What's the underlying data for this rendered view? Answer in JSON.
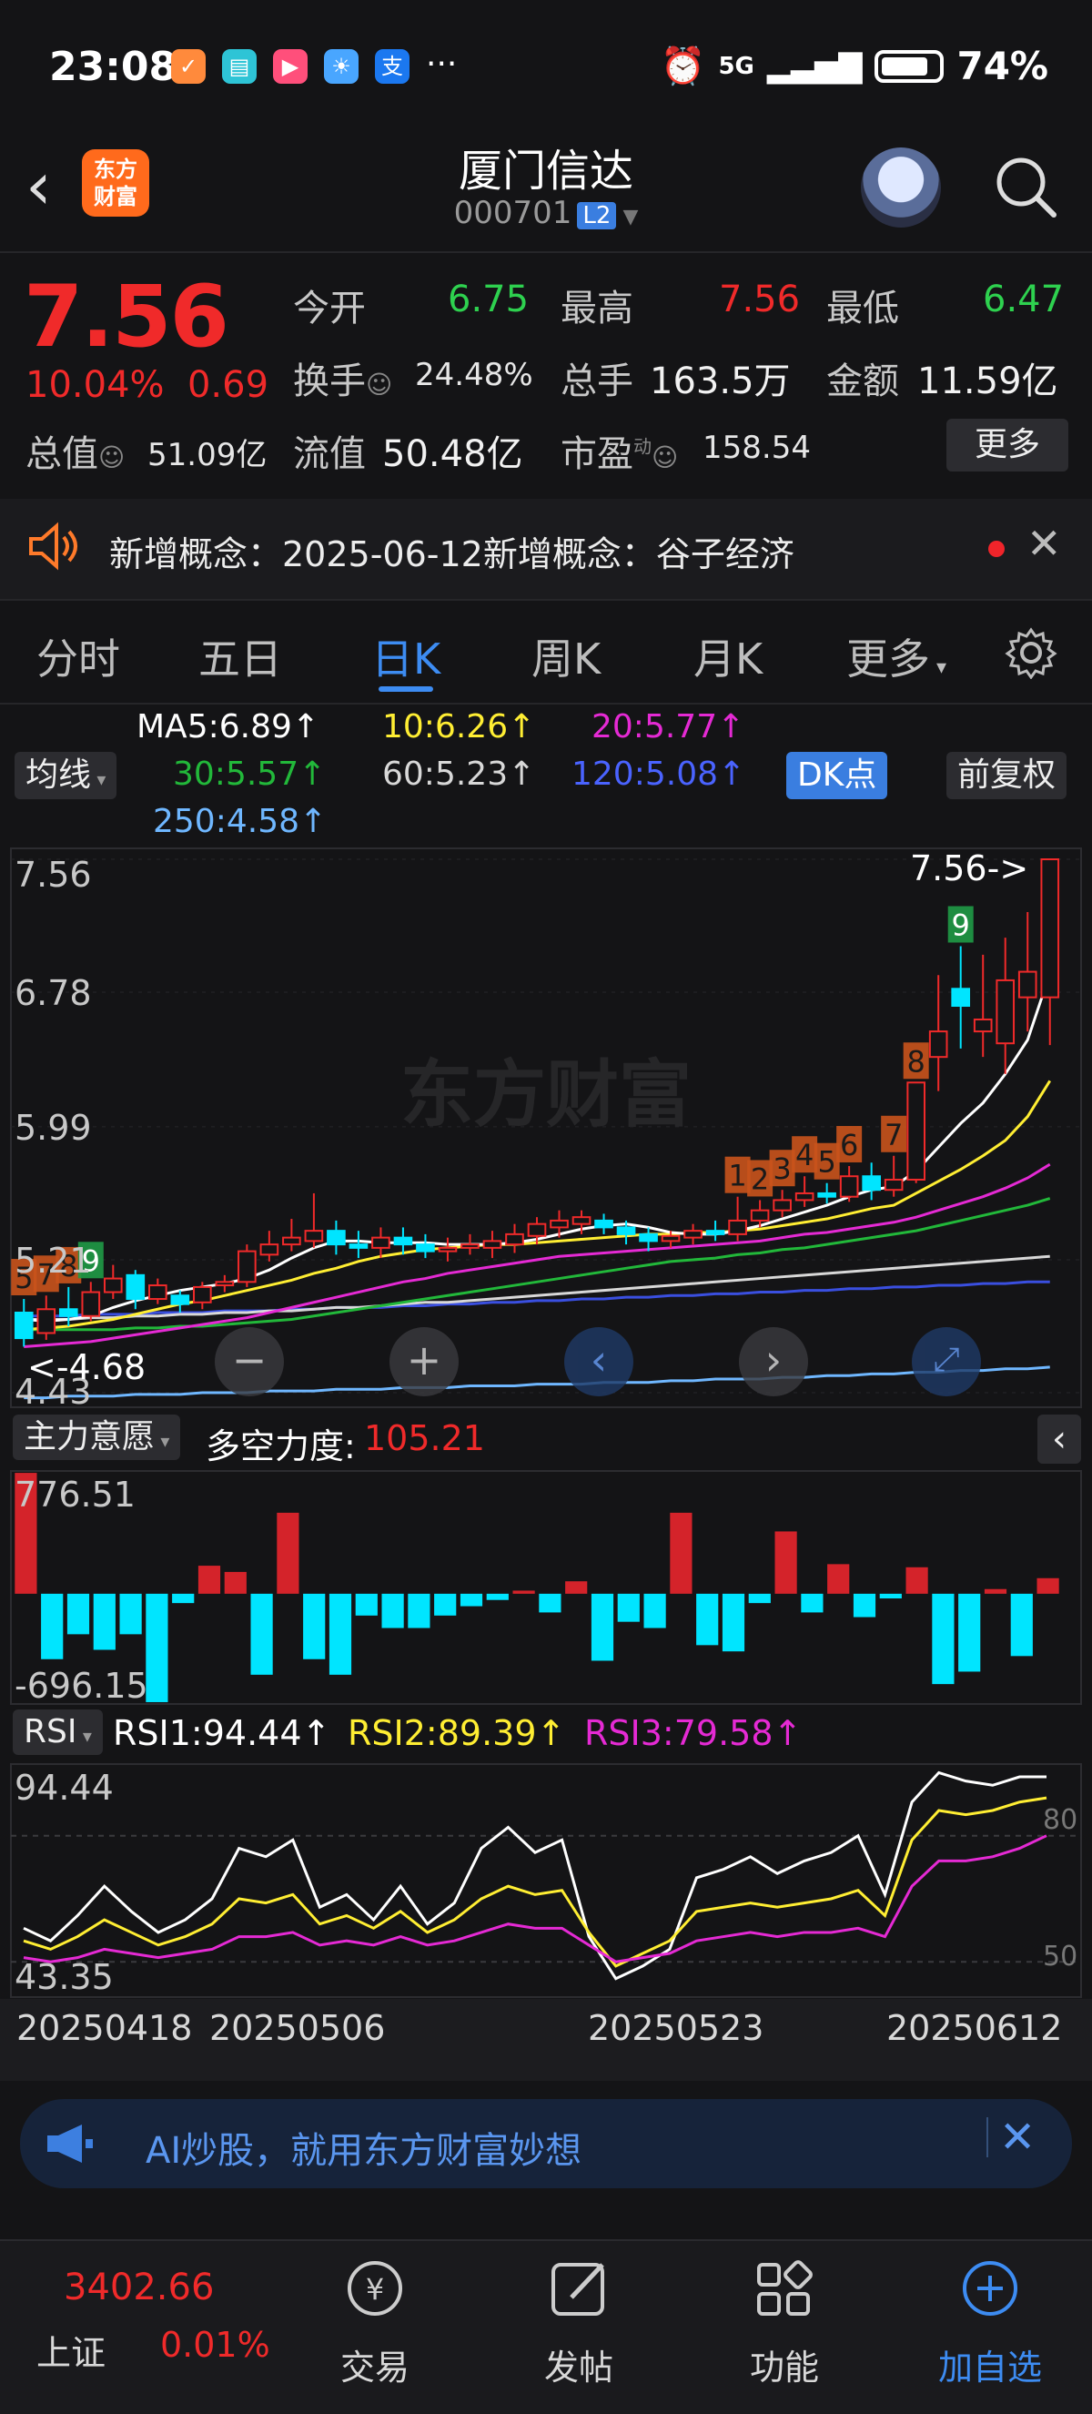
{
  "status": {
    "time": "23:08",
    "network": "5G",
    "battery": "74%",
    "more": "···",
    "app_icons": [
      "coupon-app-icon",
      "book-app-icon",
      "video-app-icon",
      "weather-app-icon",
      "alipay-icon"
    ]
  },
  "header": {
    "back_icon": "chevron-left-icon",
    "logo_line1": "东方",
    "logo_line2": "财富",
    "stock_name": "厦门信达",
    "stock_code": "000701",
    "level_badge": "L2"
  },
  "quote": {
    "price": "7.56",
    "change_pct": "10.04%",
    "change_amt": "0.69",
    "open_label": "今开",
    "open": "6.75",
    "high_label": "最高",
    "high": "7.56",
    "low_label": "最低",
    "low": "6.47",
    "turnover_label": "换手",
    "turnover": "24.48%",
    "volume_label": "总手",
    "volume": "163.5万",
    "amount_label": "金额",
    "amount": "11.59亿",
    "mcap_label": "总值",
    "mcap": "51.09亿",
    "float_label": "流值",
    "float": "50.48亿",
    "pe_label": "市盈",
    "pe_sup": "动",
    "pe": "158.54",
    "more_button": "更多"
  },
  "notice": {
    "text": "新增概念：2025-06-12新增概念：谷子经济"
  },
  "tabs": [
    "分时",
    "五日",
    "日K",
    "周K",
    "月K",
    "更多"
  ],
  "active_tab": "日K",
  "ma_legend": {
    "ma5": "MA5:6.89↑",
    "ma10": "10:6.26↑",
    "ma20": "20:5.77↑",
    "ma30": "30:5.57↑",
    "ma60": "60:5.23↑",
    "ma120": "120:5.08↑",
    "ma250": "250:4.58↑",
    "selector": "均线",
    "dk_button": "DK点",
    "adjust_button": "前复权"
  },
  "colors": {
    "up": "#f02a2a",
    "down": "#00e5ff",
    "ma5": "#ffffff",
    "ma10": "#ffee33",
    "ma20": "#e52ad4",
    "ma30": "#22b83a",
    "ma60": "#d8d8d8",
    "ma120": "#3a4fe0",
    "ma250": "#6fb7ff",
    "accent": "#3d8cf2"
  },
  "chart_data": [
    {
      "type": "candlestick",
      "title": "",
      "ylim": [
        4.43,
        7.56
      ],
      "y_ticks": [
        "7.56",
        "6.78",
        "5.99",
        "5.21",
        "4.43"
      ],
      "high_marker": "7.56->",
      "low_marker": "<-4.68",
      "dates": [
        "20250418",
        "20250506",
        "20250523",
        "20250612"
      ],
      "candles": [
        {
          "o": 4.9,
          "c": 4.75,
          "h": 4.98,
          "l": 4.7
        },
        {
          "o": 4.78,
          "c": 4.92,
          "h": 5.0,
          "l": 4.74
        },
        {
          "o": 4.92,
          "c": 4.88,
          "h": 5.05,
          "l": 4.82
        },
        {
          "o": 4.88,
          "c": 5.02,
          "h": 5.08,
          "l": 4.85
        },
        {
          "o": 5.02,
          "c": 5.1,
          "h": 5.18,
          "l": 4.98
        },
        {
          "o": 5.12,
          "c": 4.98,
          "h": 5.15,
          "l": 4.92
        },
        {
          "o": 4.98,
          "c": 5.06,
          "h": 5.1,
          "l": 4.95
        },
        {
          "o": 5.0,
          "c": 4.95,
          "h": 5.03,
          "l": 4.9
        },
        {
          "o": 4.96,
          "c": 5.05,
          "h": 5.08,
          "l": 4.92
        },
        {
          "o": 5.06,
          "c": 5.08,
          "h": 5.12,
          "l": 5.02
        },
        {
          "o": 5.08,
          "c": 5.26,
          "h": 5.3,
          "l": 5.05
        },
        {
          "o": 5.24,
          "c": 5.3,
          "h": 5.38,
          "l": 5.2
        },
        {
          "o": 5.3,
          "c": 5.34,
          "h": 5.45,
          "l": 5.26
        },
        {
          "o": 5.32,
          "c": 5.38,
          "h": 5.6,
          "l": 5.28
        },
        {
          "o": 5.38,
          "c": 5.3,
          "h": 5.44,
          "l": 5.24
        },
        {
          "o": 5.3,
          "c": 5.28,
          "h": 5.38,
          "l": 5.22
        },
        {
          "o": 5.28,
          "c": 5.34,
          "h": 5.4,
          "l": 5.22
        },
        {
          "o": 5.34,
          "c": 5.3,
          "h": 5.4,
          "l": 5.24
        },
        {
          "o": 5.3,
          "c": 5.26,
          "h": 5.36,
          "l": 5.22
        },
        {
          "o": 5.26,
          "c": 5.28,
          "h": 5.34,
          "l": 5.2
        },
        {
          "o": 5.28,
          "c": 5.3,
          "h": 5.36,
          "l": 5.24
        },
        {
          "o": 5.28,
          "c": 5.32,
          "h": 5.38,
          "l": 5.22
        },
        {
          "o": 5.3,
          "c": 5.36,
          "h": 5.42,
          "l": 5.25
        },
        {
          "o": 5.35,
          "c": 5.42,
          "h": 5.46,
          "l": 5.3
        },
        {
          "o": 5.4,
          "c": 5.44,
          "h": 5.5,
          "l": 5.34
        },
        {
          "o": 5.42,
          "c": 5.46,
          "h": 5.5,
          "l": 5.36
        },
        {
          "o": 5.44,
          "c": 5.4,
          "h": 5.48,
          "l": 5.36
        },
        {
          "o": 5.4,
          "c": 5.36,
          "h": 5.44,
          "l": 5.3
        },
        {
          "o": 5.36,
          "c": 5.32,
          "h": 5.4,
          "l": 5.26
        },
        {
          "o": 5.32,
          "c": 5.35,
          "h": 5.38,
          "l": 5.28
        },
        {
          "o": 5.34,
          "c": 5.38,
          "h": 5.42,
          "l": 5.3
        },
        {
          "o": 5.38,
          "c": 5.36,
          "h": 5.44,
          "l": 5.32
        },
        {
          "o": 5.36,
          "c": 5.44,
          "h": 5.58,
          "l": 5.32
        },
        {
          "o": 5.44,
          "c": 5.5,
          "h": 5.56,
          "l": 5.4
        },
        {
          "o": 5.5,
          "c": 5.56,
          "h": 5.62,
          "l": 5.46
        },
        {
          "o": 5.56,
          "c": 5.6,
          "h": 5.7,
          "l": 5.52
        },
        {
          "o": 5.6,
          "c": 5.58,
          "h": 5.66,
          "l": 5.54
        },
        {
          "o": 5.58,
          "c": 5.7,
          "h": 5.76,
          "l": 5.55
        },
        {
          "o": 5.7,
          "c": 5.62,
          "h": 5.78,
          "l": 5.56
        },
        {
          "o": 5.62,
          "c": 5.68,
          "h": 5.82,
          "l": 5.58
        },
        {
          "o": 5.68,
          "c": 6.25,
          "h": 6.25,
          "l": 5.66
        },
        {
          "o": 6.4,
          "c": 6.55,
          "h": 6.88,
          "l": 6.2
        },
        {
          "o": 6.8,
          "c": 6.7,
          "h": 7.05,
          "l": 6.45
        },
        {
          "o": 6.55,
          "c": 6.62,
          "h": 7.0,
          "l": 6.4
        },
        {
          "o": 6.48,
          "c": 6.85,
          "h": 7.1,
          "l": 6.3
        },
        {
          "o": 6.75,
          "c": 6.9,
          "h": 7.25,
          "l": 6.55
        },
        {
          "o": 6.75,
          "c": 7.56,
          "h": 7.56,
          "l": 6.47
        }
      ],
      "ma5": [
        4.86,
        4.85,
        4.86,
        4.88,
        4.93,
        4.97,
        5.0,
        5.03,
        5.05,
        5.07,
        5.1,
        5.15,
        5.22,
        5.28,
        5.32,
        5.32,
        5.31,
        5.31,
        5.31,
        5.3,
        5.3,
        5.3,
        5.31,
        5.33,
        5.36,
        5.39,
        5.41,
        5.42,
        5.4,
        5.37,
        5.36,
        5.36,
        5.38,
        5.41,
        5.45,
        5.49,
        5.53,
        5.58,
        5.62,
        5.64,
        5.73,
        5.87,
        6.01,
        6.13,
        6.3,
        6.5,
        6.89
      ],
      "ma10": [
        4.8,
        4.81,
        4.82,
        4.84,
        4.86,
        4.89,
        4.92,
        4.95,
        4.97,
        5.0,
        5.03,
        5.06,
        5.09,
        5.13,
        5.16,
        5.2,
        5.23,
        5.25,
        5.27,
        5.28,
        5.29,
        5.3,
        5.3,
        5.31,
        5.32,
        5.33,
        5.34,
        5.35,
        5.36,
        5.36,
        5.37,
        5.37,
        5.38,
        5.39,
        5.41,
        5.43,
        5.45,
        5.48,
        5.51,
        5.53,
        5.6,
        5.67,
        5.74,
        5.82,
        5.91,
        6.05,
        6.26
      ],
      "ma20": [
        4.7,
        4.71,
        4.72,
        4.73,
        4.75,
        4.77,
        4.79,
        4.81,
        4.83,
        4.85,
        4.87,
        4.9,
        4.93,
        4.96,
        4.99,
        5.02,
        5.05,
        5.08,
        5.1,
        5.13,
        5.15,
        5.17,
        5.19,
        5.21,
        5.23,
        5.24,
        5.25,
        5.26,
        5.27,
        5.28,
        5.29,
        5.3,
        5.31,
        5.32,
        5.34,
        5.36,
        5.37,
        5.39,
        5.41,
        5.43,
        5.46,
        5.5,
        5.54,
        5.58,
        5.63,
        5.69,
        5.77
      ],
      "ma30": [
        4.8,
        4.8,
        4.8,
        4.8,
        4.8,
        4.81,
        4.81,
        4.82,
        4.82,
        4.83,
        4.84,
        4.85,
        4.86,
        4.88,
        4.9,
        4.92,
        4.94,
        4.96,
        4.98,
        5.0,
        5.02,
        5.04,
        5.06,
        5.08,
        5.1,
        5.12,
        5.14,
        5.16,
        5.18,
        5.2,
        5.21,
        5.22,
        5.24,
        5.25,
        5.27,
        5.28,
        5.3,
        5.32,
        5.34,
        5.36,
        5.38,
        5.41,
        5.44,
        5.47,
        5.5,
        5.53,
        5.57
      ],
      "ma60": [
        4.86,
        4.86,
        4.86,
        4.87,
        4.87,
        4.88,
        4.88,
        4.89,
        4.89,
        4.9,
        4.9,
        4.91,
        4.91,
        4.92,
        4.93,
        4.93,
        4.94,
        4.95,
        4.96,
        4.96,
        4.97,
        4.98,
        4.99,
        5.0,
        5.01,
        5.02,
        5.03,
        5.04,
        5.05,
        5.06,
        5.07,
        5.08,
        5.09,
        5.1,
        5.11,
        5.12,
        5.13,
        5.14,
        5.15,
        5.16,
        5.17,
        5.18,
        5.19,
        5.2,
        5.21,
        5.22,
        5.23
      ],
      "ma120": [
        4.88,
        4.88,
        4.88,
        4.89,
        4.89,
        4.89,
        4.9,
        4.9,
        4.9,
        4.91,
        4.91,
        4.91,
        4.92,
        4.92,
        4.93,
        4.93,
        4.93,
        4.94,
        4.94,
        4.95,
        4.95,
        4.96,
        4.96,
        4.97,
        4.97,
        4.98,
        4.98,
        4.99,
        4.99,
        5.0,
        5.0,
        5.01,
        5.01,
        5.02,
        5.02,
        5.03,
        5.03,
        5.04,
        5.04,
        5.05,
        5.05,
        5.06,
        5.06,
        5.07,
        5.07,
        5.08,
        5.08
      ],
      "ma250": [
        4.4,
        4.4,
        4.41,
        4.41,
        4.41,
        4.42,
        4.42,
        4.42,
        4.43,
        4.43,
        4.43,
        4.44,
        4.44,
        4.44,
        4.45,
        4.45,
        4.45,
        4.46,
        4.46,
        4.46,
        4.47,
        4.47,
        4.47,
        4.48,
        4.48,
        4.48,
        4.49,
        4.49,
        4.49,
        4.5,
        4.5,
        4.51,
        4.51,
        4.51,
        4.52,
        4.52,
        4.53,
        4.53,
        4.54,
        4.54,
        4.55,
        4.55,
        4.56,
        4.56,
        4.57,
        4.57,
        4.58
      ],
      "signals": [
        {
          "i": 0,
          "label": "5"
        },
        {
          "i": 1,
          "label": "7"
        },
        {
          "i": 2,
          "label": "8"
        },
        {
          "i": 3,
          "label": "9"
        },
        {
          "i": 32,
          "label": "1"
        },
        {
          "i": 33,
          "label": "2"
        },
        {
          "i": 34,
          "label": "3"
        },
        {
          "i": 35,
          "label": "4"
        },
        {
          "i": 36,
          "label": "5"
        },
        {
          "i": 37,
          "label": "6"
        },
        {
          "i": 39,
          "label": "7"
        },
        {
          "i": 40,
          "label": "8"
        },
        {
          "i": 42,
          "label": "9"
        }
      ]
    },
    {
      "type": "bar",
      "title": "主力意愿",
      "indicator_label": "多空力度:",
      "indicator_value": "105.21",
      "ymax_label": "776.51",
      "ymin_label": "-696.15",
      "ylim": [
        -696.15,
        776.51
      ],
      "values": [
        776,
        -420,
        -260,
        -360,
        -260,
        -696,
        -60,
        180,
        140,
        -520,
        520,
        -420,
        -520,
        -140,
        -220,
        -220,
        -140,
        -80,
        -40,
        20,
        -120,
        80,
        -430,
        -180,
        -220,
        520,
        -330,
        -370,
        -60,
        400,
        -120,
        190,
        -150,
        -30,
        170,
        -580,
        -500,
        30,
        -400,
        100
      ]
    },
    {
      "type": "line",
      "title": "RSI",
      "rsi1": "RSI1:94.44↑",
      "rsi2": "RSI2:89.39↑",
      "rsi3": "RSI3:79.58↑",
      "ymax_label": "94.44",
      "ymin_label": "43.35",
      "ref_lines": [
        "80",
        "50"
      ],
      "ylim": [
        43.35,
        94.44
      ],
      "series": [
        {
          "name": "RSI1",
          "values": [
            58,
            55,
            61,
            68,
            62,
            57,
            60,
            65,
            77,
            75,
            79,
            63,
            66,
            60,
            68,
            59,
            64,
            77,
            82,
            76,
            79,
            56,
            46,
            49,
            53,
            70,
            72,
            75,
            71,
            74,
            76,
            80,
            66,
            88,
            95,
            93,
            92,
            94,
            94
          ]
        },
        {
          "name": "RSI2",
          "values": [
            55,
            53,
            56,
            60,
            57,
            54,
            56,
            59,
            65,
            64,
            66,
            59,
            61,
            58,
            62,
            57,
            60,
            65,
            68,
            66,
            67,
            57,
            49,
            52,
            55,
            62,
            63,
            64,
            63,
            64,
            65,
            67,
            61,
            79,
            86,
            85,
            86,
            88,
            89
          ]
        },
        {
          "name": "RSI3",
          "values": [
            51,
            50,
            51,
            53,
            52,
            51,
            52,
            53,
            56,
            56,
            57,
            54,
            55,
            54,
            56,
            54,
            55,
            57,
            59,
            58,
            58,
            54,
            50,
            51,
            52,
            55,
            56,
            57,
            56,
            57,
            57,
            58,
            56,
            68,
            74,
            74,
            75,
            77,
            80
          ]
        }
      ]
    }
  ],
  "main_chart_selector": "均线",
  "flow_selector": "主力意愿",
  "rsi_selector": "RSI",
  "banner": {
    "text": "AI炒股，就用东方财富妙想"
  },
  "bottom": {
    "index_value": "3402.66",
    "index_name": "上证",
    "index_change": "0.01%",
    "items": [
      "交易",
      "发帖",
      "功能",
      "加自选"
    ]
  }
}
